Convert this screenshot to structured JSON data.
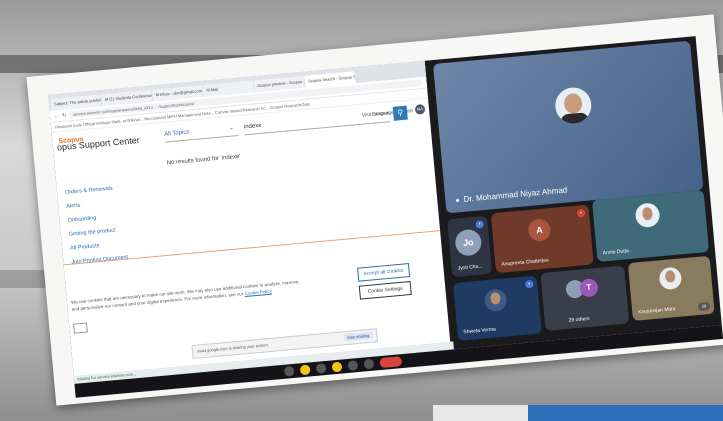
{
  "browser": {
    "tabs": [
      "Subject: The article published...",
      "M (1) Studenta Conference Wo...",
      "M Inbox - abc@gmail.com",
      "M Mail",
      "Scopus preview - Scopus - M...",
      "Scopus Search - Scopus Su..."
    ],
    "url": "service.elsevier.com/app/answers/list/a_id/13 ... /supporthub/scopus/",
    "bookmarks": "Research tools   Official Writings   Mark, at Wiki/an...   Recruitment   MiPH   Management Note...   Canvas   Impact/Research Sc...   Scopus   ResearchGate",
    "brand": "Scopus",
    "visit_scopus": "Visit Scopus",
    "language": "Language: English",
    "user_initials": "MA",
    "support_title": "opus Support Center",
    "topic_select": "All Topics",
    "search_query": "indexe",
    "no_results": "No results found for 'indexe'",
    "topics": [
      "Orders & Renewals",
      "Alerts",
      "Onboarding",
      "Getting the product",
      "All Products",
      "Join Printing Document"
    ],
    "cookie_text": "We use cookies that are necessary to make our site work. We may also use additional cookies to analyze, improve, and personalize our content and your digital experience. For more information, see our",
    "cookie_link": "Cookie Policy",
    "accept_label": "Accept all cookies",
    "cookie_settings_label": "Cookie Settings",
    "share_text": "meet.google.com is sharing your screen.",
    "stop_label": "Stop sharing",
    "hide_label": "Hide",
    "status_text": "Waiting for service.elsevier.com..."
  },
  "meeting": {
    "presenter": "Dr. Mohammad Niyaz Ahmad",
    "participants": [
      {
        "name": "Jyoti Chu...",
        "initial": "Jo",
        "color": "#8f9fb8"
      },
      {
        "name": "Anupreeta Chatterjee",
        "initial": "A",
        "color": "#a9563e"
      },
      {
        "name": "Annie Dutta",
        "initial": "",
        "color": "#4f7988"
      },
      {
        "name": "Shweta Verma",
        "initial": "",
        "color": "#2c4a7a"
      },
      {
        "name": "29 others",
        "initial": "T",
        "color": "#9b59b6"
      },
      {
        "name": "Koustuvjan Mitra",
        "initial": "",
        "color": "#8a7a5e"
      }
    ],
    "others_count": "29"
  },
  "colors": {
    "brand_orange": "#e9711c",
    "link_blue": "#2a6db5",
    "meet_dark": "#1b1b1e"
  }
}
